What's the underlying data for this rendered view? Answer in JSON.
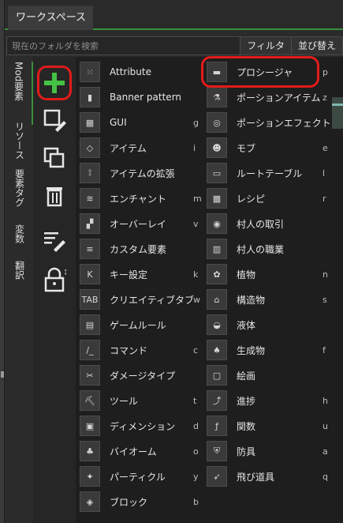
{
  "tab": {
    "label": "ワークスペース"
  },
  "search": {
    "placeholder": "現在のフォルダを検索",
    "value": ""
  },
  "buttons": {
    "filter": "フィルタ",
    "sort": "並び替え"
  },
  "vertical_tabs": [
    "Mod要素",
    "リソース",
    "要素タグ",
    "変数",
    "翻訳"
  ],
  "tools": [
    "add-icon",
    "edit-element-icon",
    "duplicate-icon",
    "delete-icon",
    "edit-list-icon",
    "lock-icon"
  ],
  "left_items": [
    {
      "label": "Attribute",
      "key": "",
      "icon": "attribute-icon",
      "glyph": "⁙"
    },
    {
      "label": "Banner pattern",
      "key": "",
      "icon": "banner-icon",
      "glyph": "▮"
    },
    {
      "label": "GUI",
      "key": "g",
      "icon": "gui-icon",
      "glyph": "▦"
    },
    {
      "label": "アイテム",
      "key": "i",
      "icon": "item-icon",
      "glyph": "◇"
    },
    {
      "label": "アイテムの拡張",
      "key": "",
      "icon": "item-extension-icon",
      "glyph": "⟟"
    },
    {
      "label": "エンチャント",
      "key": "m",
      "icon": "enchant-icon",
      "glyph": "≋"
    },
    {
      "label": "オーバーレイ",
      "key": "v",
      "icon": "overlay-icon",
      "glyph": "▞"
    },
    {
      "label": "カスタム要素",
      "key": "",
      "icon": "custom-element-icon",
      "glyph": "≡"
    },
    {
      "label": "キー設定",
      "key": "k",
      "icon": "keybind-icon",
      "glyph": "K"
    },
    {
      "label": "クリエイティブタブ",
      "key": "w",
      "icon": "creative-tab-icon",
      "glyph": "TAB"
    },
    {
      "label": "ゲームルール",
      "key": "",
      "icon": "gamerule-icon",
      "glyph": "▤"
    },
    {
      "label": "コマンド",
      "key": "c",
      "icon": "command-icon",
      "glyph": "/_"
    },
    {
      "label": "ダメージタイプ",
      "key": "",
      "icon": "damage-type-icon",
      "glyph": "✂"
    },
    {
      "label": "ツール",
      "key": "t",
      "icon": "tool-icon",
      "glyph": "⛏"
    },
    {
      "label": "ディメンション",
      "key": "d",
      "icon": "dimension-icon",
      "glyph": "▣"
    },
    {
      "label": "バイオーム",
      "key": "o",
      "icon": "biome-icon",
      "glyph": "♣"
    },
    {
      "label": "パーティクル",
      "key": "y",
      "icon": "particle-icon",
      "glyph": "✦"
    },
    {
      "label": "ブロック",
      "key": "b",
      "icon": "block-icon",
      "glyph": "◈"
    }
  ],
  "right_items": [
    {
      "label": "プロシージャ",
      "key": "p",
      "icon": "procedure-icon",
      "glyph": "▬"
    },
    {
      "label": "ポーションアイテム",
      "key": "z",
      "icon": "potion-item-icon",
      "glyph": "⚗"
    },
    {
      "label": "ポーションエフェクト",
      "key": "",
      "icon": "potion-effect-icon",
      "glyph": "◎"
    },
    {
      "label": "モブ",
      "key": "e",
      "icon": "mob-icon",
      "glyph": "☻"
    },
    {
      "label": "ルートテーブル",
      "key": "l",
      "icon": "loot-table-icon",
      "glyph": "▭"
    },
    {
      "label": "レシピ",
      "key": "r",
      "icon": "recipe-icon",
      "glyph": "▩"
    },
    {
      "label": "村人の取引",
      "key": "",
      "icon": "villager-trade-icon",
      "glyph": "◉"
    },
    {
      "label": "村人の職業",
      "key": "",
      "icon": "villager-profession-icon",
      "glyph": "▥"
    },
    {
      "label": "植物",
      "key": "n",
      "icon": "plant-icon",
      "glyph": "✿"
    },
    {
      "label": "構造物",
      "key": "s",
      "icon": "structure-icon",
      "glyph": "⌂"
    },
    {
      "label": "液体",
      "key": "",
      "icon": "fluid-icon",
      "glyph": "◒"
    },
    {
      "label": "生成物",
      "key": "f",
      "icon": "feature-icon",
      "glyph": "♠"
    },
    {
      "label": "絵画",
      "key": "",
      "icon": "painting-icon",
      "glyph": "▢"
    },
    {
      "label": "進捗",
      "key": "h",
      "icon": "advancement-icon",
      "glyph": "⤴"
    },
    {
      "label": "関数",
      "key": "u",
      "icon": "function-icon",
      "glyph": "ƒ"
    },
    {
      "label": "防具",
      "key": "a",
      "icon": "armor-icon",
      "glyph": "⛨"
    },
    {
      "label": "飛び道具",
      "key": "q",
      "icon": "projectile-icon",
      "glyph": "➶"
    }
  ],
  "colors": {
    "accent": "#3b8f3b",
    "highlight": "#e21b1b",
    "add_green": "#45c245"
  }
}
